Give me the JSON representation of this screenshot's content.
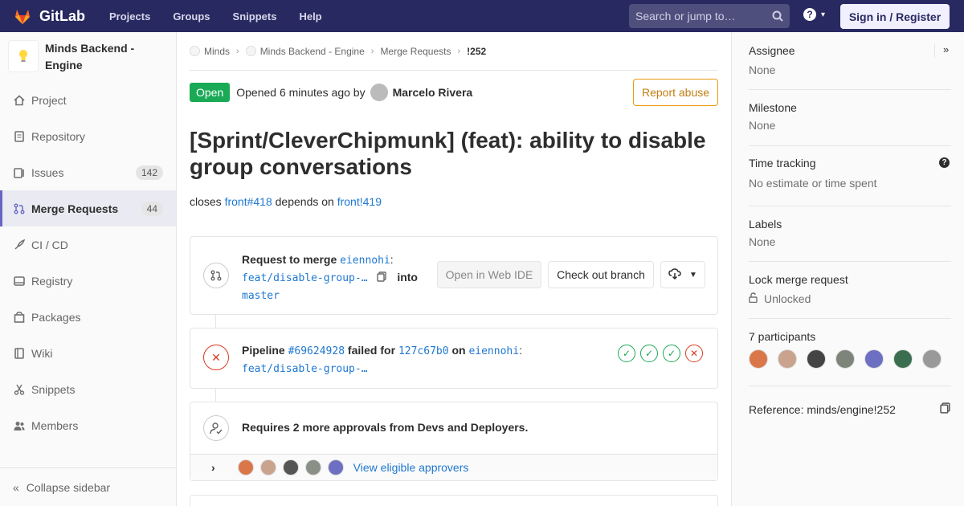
{
  "topnav": {
    "brand": "GitLab",
    "links": [
      "Projects",
      "Groups",
      "Snippets",
      "Help"
    ],
    "search_placeholder": "Search or jump to…",
    "signin": "Sign in / Register"
  },
  "sidebar": {
    "project_name": "Minds Backend - Engine",
    "items": [
      {
        "label": "Project",
        "icon": "home-icon"
      },
      {
        "label": "Repository",
        "icon": "doc-icon"
      },
      {
        "label": "Issues",
        "icon": "issues-icon",
        "count": "142"
      },
      {
        "label": "Merge Requests",
        "icon": "merge-request-icon",
        "count": "44"
      },
      {
        "label": "CI / CD",
        "icon": "rocket-icon"
      },
      {
        "label": "Registry",
        "icon": "disk-icon"
      },
      {
        "label": "Packages",
        "icon": "package-icon"
      },
      {
        "label": "Wiki",
        "icon": "book-icon"
      },
      {
        "label": "Snippets",
        "icon": "scissors-icon"
      },
      {
        "label": "Members",
        "icon": "users-icon"
      }
    ],
    "collapse": "Collapse sidebar"
  },
  "breadcrumb": [
    "Minds",
    "Minds Backend - Engine",
    "Merge Requests",
    "!252"
  ],
  "status": {
    "badge": "Open",
    "opened": "Opened 6 minutes ago by",
    "author": "Marcelo Rivera",
    "report": "Report abuse"
  },
  "title": "[Sprint/CleverChipmunk] (feat): ability to disable group conversations",
  "description": {
    "closes": "closes",
    "closes_ref": "front#418",
    "depends": "depends on",
    "depends_ref": "front!419"
  },
  "merge": {
    "request_to_merge": "Request to merge",
    "source_owner": "eiennohi",
    "source_branch": "feat/disable-group-…",
    "into": "into",
    "target_branch": "master",
    "web_ide": "Open in Web IDE",
    "checkout": "Check out branch"
  },
  "pipeline": {
    "label": "Pipeline",
    "id": "#69624928",
    "failed_for": "failed for",
    "commit": "127c67b0",
    "on": "on",
    "owner": "eiennohi",
    "branch": "feat/disable-group-…",
    "stages": [
      "passed",
      "passed",
      "passed",
      "failed"
    ]
  },
  "approvals": {
    "text": "Requires 2 more approvals from Devs and Deployers.",
    "view": "View eligible approvers",
    "avatar_colors": [
      "#d9774a",
      "#c9a38e",
      "#555555",
      "#8a8f88",
      "#6d6fc2"
    ]
  },
  "right": {
    "assignee_label": "Assignee",
    "assignee_value": "None",
    "milestone_label": "Milestone",
    "milestone_value": "None",
    "time_label": "Time tracking",
    "time_value": "No estimate or time spent",
    "labels_label": "Labels",
    "labels_value": "None",
    "lock_label": "Lock merge request",
    "lock_value": "Unlocked",
    "participants_label": "7 participants",
    "participant_colors": [
      "#d9774a",
      "#c9a38e",
      "#444444",
      "#7d857a",
      "#6d6fc2",
      "#3a6e4f",
      "#999999"
    ],
    "reference": "Reference: minds/engine!252"
  }
}
